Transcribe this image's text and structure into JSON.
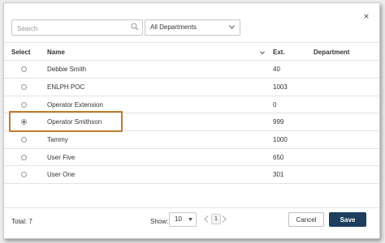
{
  "dialog": {
    "close_label": "×"
  },
  "filters": {
    "search_placeholder": "Search",
    "department_selected": "All Departments"
  },
  "table": {
    "columns": [
      "Select",
      "Name",
      "Ext.",
      "Department"
    ],
    "rows": [
      {
        "name": "Debbie Smith",
        "ext": "40",
        "department": "",
        "selected": false
      },
      {
        "name": "ENLPH POC",
        "ext": "1003",
        "department": "",
        "selected": false
      },
      {
        "name": "Operator Extension",
        "ext": "0",
        "department": "",
        "selected": false
      },
      {
        "name": "Operator Smithson",
        "ext": "999",
        "department": "",
        "selected": true
      },
      {
        "name": "Tammy",
        "ext": "1000",
        "department": "",
        "selected": false
      },
      {
        "name": "User Five",
        "ext": "650",
        "department": "",
        "selected": false
      },
      {
        "name": "User One",
        "ext": "301",
        "department": "",
        "selected": false
      }
    ]
  },
  "footer": {
    "total": "Total: 7",
    "show_label": "Show:",
    "page_size": "10",
    "current_page": "1",
    "cancel_label": "Cancel",
    "save_label": "Save"
  },
  "colors": {
    "highlight": "#c17a2e",
    "primary": "#1d3e5e"
  }
}
